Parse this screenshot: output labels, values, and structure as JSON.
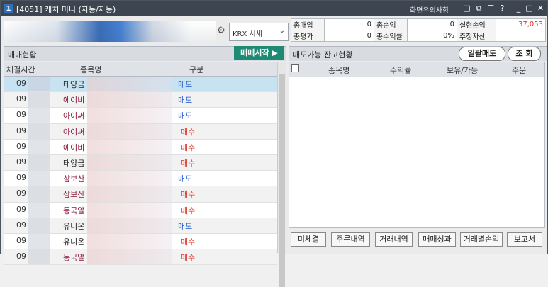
{
  "window": {
    "number": "1",
    "title": "[4051] 캐치 미니 (자동/자동)",
    "caution": "화면유의사항"
  },
  "icons": [
    "window-icon",
    "restore-icon",
    "pin-icon",
    "help-icon",
    "minimize-icon",
    "maximize-icon",
    "close-icon"
  ],
  "market_select": {
    "value": "KRX 시세"
  },
  "summary": {
    "rows": [
      [
        {
          "label": "총매입",
          "value": "0"
        },
        {
          "label": "총손익",
          "value": "0"
        },
        {
          "label": "실현손익",
          "value": "37,053"
        }
      ],
      [
        {
          "label": "총평가",
          "value": "0"
        },
        {
          "label": "총수익률",
          "value": "0%"
        },
        {
          "label": "추정자산",
          "value": ""
        }
      ]
    ]
  },
  "left_panel": {
    "title": "매매현황",
    "start_button": "매매시작 ▶",
    "columns": [
      "체결시간",
      "종목명",
      "구분"
    ],
    "rows": [
      {
        "time": "09",
        "name": "태양금",
        "side": "매도",
        "type": "sell",
        "sel": true
      },
      {
        "time": "09",
        "name": "에이비",
        "side": "매도",
        "type": "sell"
      },
      {
        "time": "09",
        "name": "아이써",
        "side": "매도",
        "type": "sell"
      },
      {
        "time": "09",
        "name": "아이써",
        "side": "매수",
        "type": "buy"
      },
      {
        "time": "09",
        "name": "에이비",
        "side": "매수",
        "type": "buy"
      },
      {
        "time": "09",
        "name": "태양금",
        "side": "매수",
        "type": "buy"
      },
      {
        "time": "09",
        "name": "삼보산",
        "side": "매도",
        "type": "sell"
      },
      {
        "time": "09",
        "name": "삼보산",
        "side": "매수",
        "type": "buy"
      },
      {
        "time": "09",
        "name": "동국알",
        "side": "매수",
        "type": "buy"
      },
      {
        "time": "09",
        "name": "유니온",
        "side": "매도",
        "type": "sell"
      },
      {
        "time": "09",
        "name": "유니온",
        "side": "매수",
        "type": "buy"
      },
      {
        "time": "09",
        "name": "동국알",
        "side": "매수",
        "type": "buy"
      }
    ]
  },
  "right_panel": {
    "title": "매도가능 잔고현황",
    "bulk_sell_button": "일괄매도",
    "query_button": "조 회",
    "columns": [
      "종목명",
      "수익률",
      "보유/가능",
      "주문"
    ]
  },
  "bottom_buttons": [
    "미체결",
    "주문내역",
    "거래내역",
    "매매성과",
    "거래별손익",
    "보고서"
  ],
  "colors": {
    "buy": "#e0352a",
    "sell": "#1e57c8",
    "start_button": "#1e8a74",
    "titlebar": "#3c4550"
  }
}
